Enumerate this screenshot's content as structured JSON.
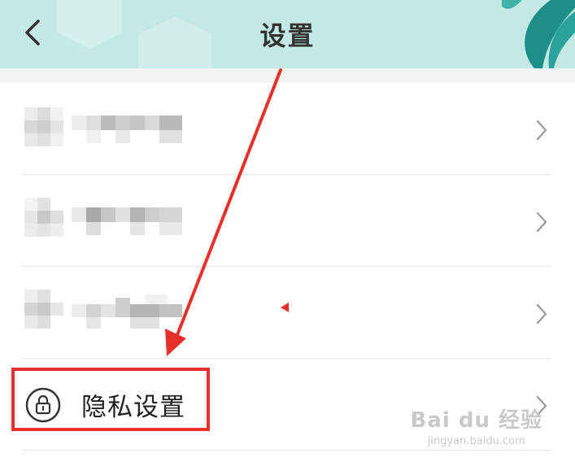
{
  "header": {
    "title": "设置",
    "back_icon": "chevron-left-icon",
    "background": "#c4e8e4"
  },
  "list": {
    "items": [
      {
        "label": "",
        "blurred": true
      },
      {
        "label": "",
        "blurred": true
      },
      {
        "label": "",
        "blurred": true
      },
      {
        "label": "隐私设置",
        "icon": "lock-icon",
        "blurred": false
      }
    ],
    "chevron_icon": "chevron-right-icon"
  },
  "annotation": {
    "highlight_color": "#e8302a",
    "arrow_color": "#e8302a"
  },
  "watermark": {
    "brand": "Bai du 经验",
    "url": "jingyan.baidu.com"
  }
}
